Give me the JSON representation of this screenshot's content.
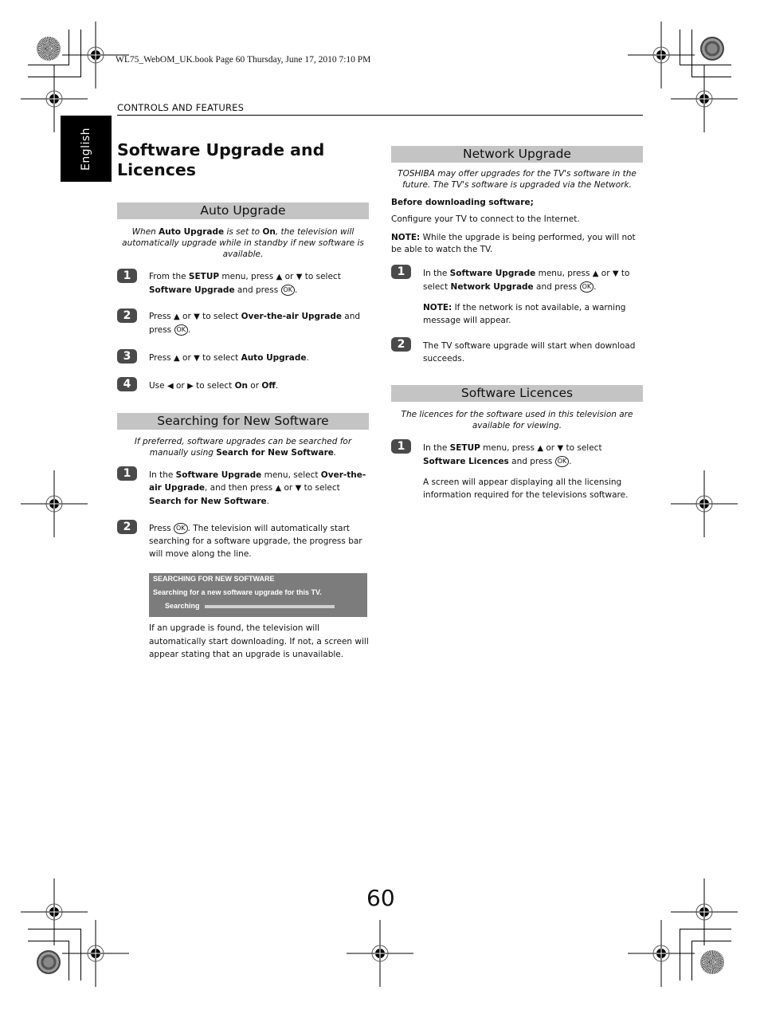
{
  "print_info": "WL75_WebOM_UK.book  Page 60  Thursday, June 17, 2010  7:10 PM",
  "running_header": "CONTROLS AND FEATURES",
  "language_tab": "English",
  "page_title": "Software Upgrade and Licences",
  "page_number": "60",
  "icons": {
    "up": "▲",
    "down": "▼",
    "left": "◀",
    "right": "▶",
    "ok": "OK"
  },
  "auto_upgrade": {
    "heading": "Auto Upgrade",
    "intro": [
      "When ",
      "Auto Upgrade",
      " is set to ",
      "On",
      ", the television will automatically upgrade while in standby if new software is available."
    ],
    "steps": [
      {
        "num": "1",
        "parts": [
          "From the ",
          "SETUP",
          " menu, press ",
          "▲",
          " or ",
          "▼",
          " to select ",
          "Software Upgrade",
          " and press ",
          "OK",
          "."
        ]
      },
      {
        "num": "2",
        "parts": [
          "Press ",
          "▲",
          " or ",
          "▼",
          " to select ",
          "Over-the-air Upgrade",
          " and press ",
          "OK",
          "."
        ]
      },
      {
        "num": "3",
        "parts": [
          "Press ",
          "▲",
          " or ",
          "▼",
          " to select ",
          "Auto Upgrade",
          "."
        ]
      },
      {
        "num": "4",
        "parts": [
          "Use ",
          "◀",
          " or ",
          "▶",
          " to select ",
          "On",
          " or ",
          "Off",
          "."
        ]
      }
    ]
  },
  "searching": {
    "heading": "Searching for New Software",
    "intro": [
      "If preferred, software upgrades can be searched for manually using ",
      "Search for New Software",
      "."
    ],
    "steps": [
      {
        "num": "1",
        "parts": [
          "In the ",
          "Software Upgrade",
          " menu, select ",
          "Over-the-air Upgrade",
          ", and then press ",
          "▲",
          " or ",
          "▼",
          " to select ",
          "Search for New Software",
          "."
        ]
      },
      {
        "num": "2",
        "parts": [
          "Press ",
          "OK",
          ". The television will automatically start searching for a software upgrade, the progress bar will move along the line."
        ]
      }
    ],
    "osd": {
      "title": "SEARCHING FOR NEW SOFTWARE",
      "message": "Searching for a new software upgrade for this TV.",
      "status_label": "Searching",
      "progress_percent": 100
    },
    "after": "If an upgrade is found, the television will automatically start downloading. If not, a screen will appear stating that an upgrade is unavailable."
  },
  "network_upgrade": {
    "heading": "Network Upgrade",
    "intro": "TOSHIBA may offer upgrades for the TV's software in the future. The TV's software is upgraded via the Network.",
    "before_label": "Before downloading software;",
    "configure": "Configure your TV to connect to the Internet.",
    "note_label": "NOTE:",
    "note": " While the upgrade is being performed, you will not be able to watch the TV.",
    "steps": [
      {
        "num": "1",
        "parts": [
          "In the ",
          "Software Upgrade",
          " menu, press ",
          "▲",
          " or ",
          "▼",
          " to select ",
          "Network Upgrade",
          " and press ",
          "OK",
          "."
        ]
      },
      {
        "num": "2",
        "parts": [
          "The TV software upgrade will start when download succeeds."
        ]
      }
    ],
    "step1_note_label": "NOTE:",
    "step1_note": " If the network is not available, a warning message will appear."
  },
  "licences": {
    "heading": "Software Licences",
    "intro": "The licences for the software used in this television are available for viewing.",
    "steps": [
      {
        "num": "1",
        "parts": [
          "In the ",
          "SETUP",
          " menu,  press ",
          "▲",
          " or ",
          "▼",
          " to select ",
          "Software Licences",
          " and press ",
          "OK",
          "."
        ]
      }
    ],
    "after": "A screen will appear displaying all the licensing information required for the televisions software."
  }
}
